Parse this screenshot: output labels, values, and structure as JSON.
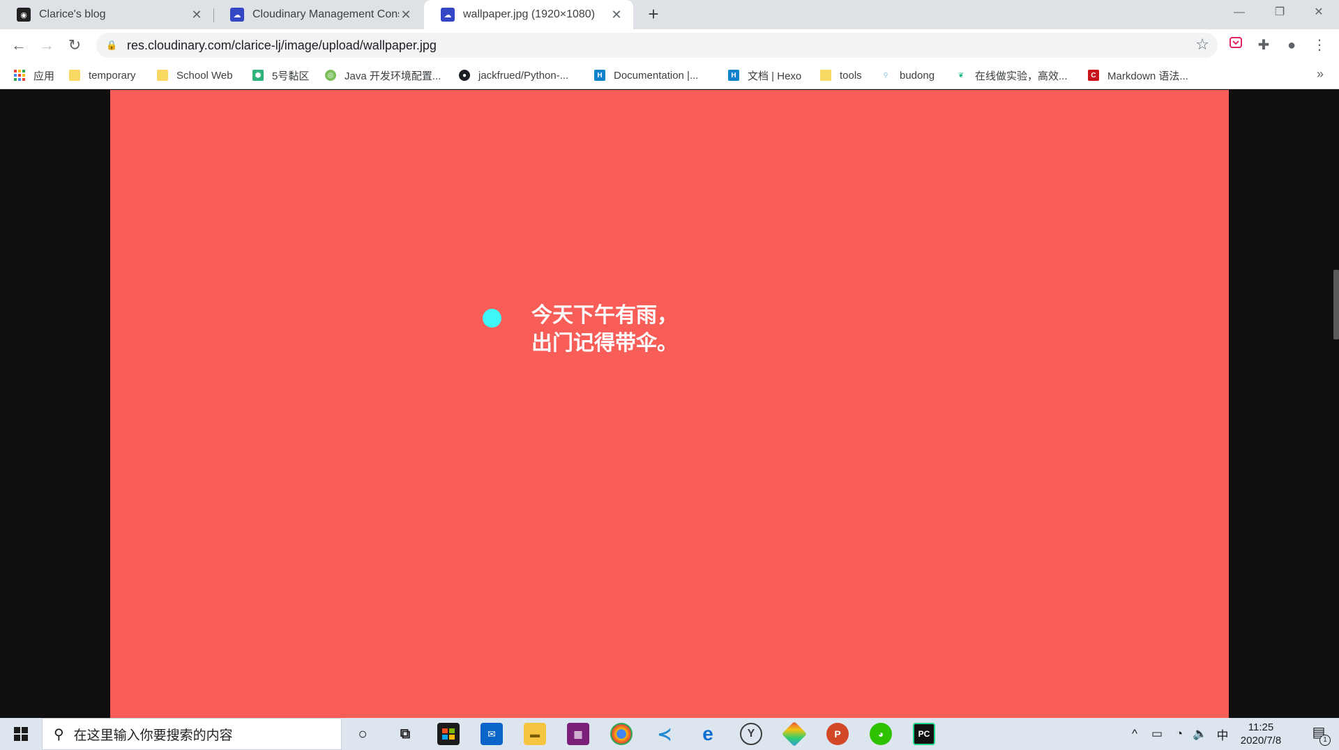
{
  "browser": {
    "tabs": [
      {
        "title": "Clarice's blog",
        "favicon": "avatar-icon",
        "active": false
      },
      {
        "title": "Cloudinary Management Cons",
        "favicon": "cloudinary-icon",
        "active": false
      },
      {
        "title": "wallpaper.jpg (1920×1080)",
        "favicon": "cloudinary-icon",
        "active": true
      }
    ],
    "new_tab": "+",
    "url": "res.cloudinary.com/clarice-lj/image/upload/wallpaper.jpg"
  },
  "bookmarks": [
    {
      "label": "应用",
      "icon": "apps-grid-icon"
    },
    {
      "label": "temporary",
      "icon": "folder-icon"
    },
    {
      "label": "School Web",
      "icon": "folder-icon"
    },
    {
      "label": "5号黏区",
      "icon": "hexagon-icon"
    },
    {
      "label": "Java 开发环境配置...",
      "icon": "site-icon"
    },
    {
      "label": "jackfrued/Python-...",
      "icon": "github-icon"
    },
    {
      "label": "Documentation |...",
      "icon": "hexo-icon"
    },
    {
      "label": "文档 | Hexo",
      "icon": "hexo-icon"
    },
    {
      "label": "tools",
      "icon": "folder-icon"
    },
    {
      "label": "budong",
      "icon": "site-icon"
    },
    {
      "label": "在线做实验，高效...",
      "icon": "leaf-icon"
    },
    {
      "label": "Markdown 语法...",
      "icon": "csdn-icon"
    }
  ],
  "bookmarks_more": "»",
  "page": {
    "quote_line1": "今天下午有雨，",
    "quote_line2": "出门记得带伞。",
    "background_color": "#f95d58",
    "dot_color": "#3ff5f5"
  },
  "taskbar": {
    "search_placeholder": "在这里输入你要搜索的内容",
    "apps": [
      "cortana-icon",
      "task-view-icon",
      "store-icon",
      "mail-icon",
      "file-explorer-icon",
      "winrar-icon",
      "chrome-icon",
      "vscode-icon",
      "edge-icon",
      "clock-app-icon",
      "git-icon",
      "powerpoint-icon",
      "wechat-icon",
      "pycharm-icon"
    ],
    "ime": "中",
    "time": "11:25",
    "date": "2020/7/8",
    "notification_count": "1"
  }
}
